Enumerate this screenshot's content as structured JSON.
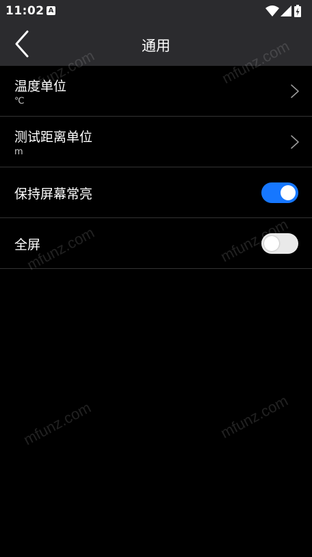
{
  "status_bar": {
    "time": "11:02",
    "notification_icon": "a-notification-icon",
    "right_icons": [
      "wifi-icon",
      "signal-icon",
      "battery-icon"
    ]
  },
  "header": {
    "title": "通用",
    "back_icon": "back-chevron-icon"
  },
  "settings": {
    "temperature_unit": {
      "label": "温度单位",
      "value": "℃"
    },
    "distance_unit": {
      "label": "测试距离单位",
      "value": "m"
    },
    "keep_screen_on": {
      "label": "保持屏幕常亮",
      "enabled": true
    },
    "fullscreen": {
      "label": "全屏",
      "enabled": false
    }
  },
  "watermark": "mfunz.com",
  "colors": {
    "background": "#000000",
    "header_background": "#2b2b2e",
    "divider": "#333333",
    "toggle_on": "#1677ff",
    "toggle_off": "#e9e9e9"
  }
}
